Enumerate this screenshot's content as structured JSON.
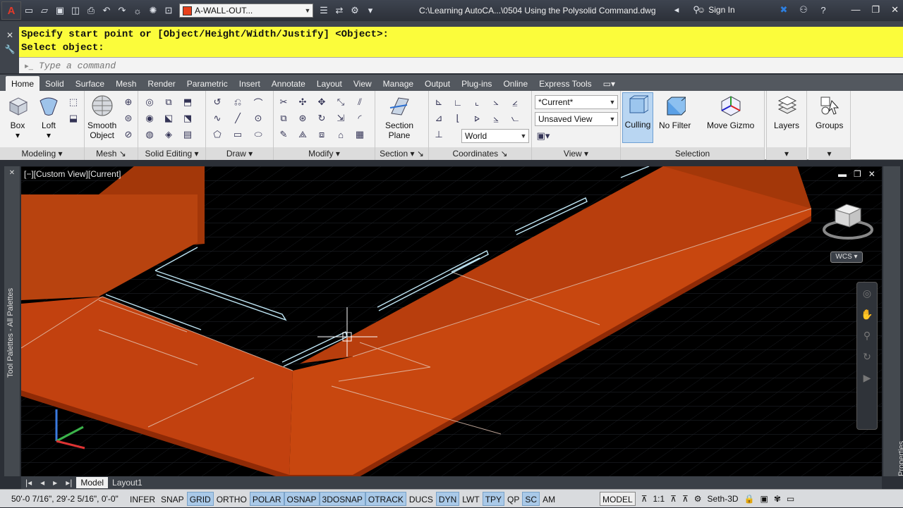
{
  "titlebar": {
    "layer_name": "A-WALL-OUT...",
    "file_title": "C:\\Learning AutoCA...\\0504 Using the Polysolid Command.dwg",
    "signin": "Sign In",
    "layer_color": "#e8401c"
  },
  "command": {
    "history": [
      "Specify start point or [Object/Height/Width/Justify] <Object>:",
      "Select object:"
    ],
    "placeholder": "Type a command",
    "highlight_color": "#fbfc3b"
  },
  "ribbon": {
    "tabs": [
      "Home",
      "Solid",
      "Surface",
      "Mesh",
      "Render",
      "Parametric",
      "Insert",
      "Annotate",
      "Layout",
      "View",
      "Manage",
      "Output",
      "Plug-ins",
      "Online",
      "Express Tools"
    ],
    "active_tab": "Home",
    "panels": {
      "modeling": "Modeling",
      "mesh": "Mesh",
      "solid_editing": "Solid Editing",
      "draw": "Draw",
      "modify": "Modify",
      "section": "Section",
      "coordinates": "Coordinates",
      "view": "View",
      "selection": "Selection"
    },
    "buttons": {
      "box": "Box",
      "loft": "Loft",
      "smooth_object": [
        "Smooth",
        "Object"
      ],
      "section_plane": [
        "Section",
        "Plane"
      ],
      "culling": "Culling",
      "no_filter": "No Filter",
      "move_gizmo": "Move Gizmo",
      "layers": "Layers",
      "groups": "Groups"
    },
    "combos": {
      "visual_style": "*Current*",
      "named_view": "Unsaved View",
      "ucs": "World"
    }
  },
  "viewport": {
    "label": "[−][Custom View][Current]",
    "wcs": "WCS"
  },
  "palettes": {
    "left": "Tool Palettes - All Palettes",
    "right": "Properties"
  },
  "layout_tabs": [
    "Model",
    "Layout1"
  ],
  "status": {
    "coords": "50'-0 7/16\", 29'-2 5/16\", 0'-0\"",
    "toggles": [
      {
        "label": "INFER",
        "on": false
      },
      {
        "label": "SNAP",
        "on": false
      },
      {
        "label": "GRID",
        "on": true
      },
      {
        "label": "ORTHO",
        "on": false
      },
      {
        "label": "POLAR",
        "on": true
      },
      {
        "label": "OSNAP",
        "on": true
      },
      {
        "label": "3DOSNAP",
        "on": true
      },
      {
        "label": "OTRACK",
        "on": true
      },
      {
        "label": "DUCS",
        "on": false
      },
      {
        "label": "DYN",
        "on": true
      },
      {
        "label": "LWT",
        "on": false
      },
      {
        "label": "TPY",
        "on": true
      },
      {
        "label": "QP",
        "on": false
      },
      {
        "label": "SC",
        "on": true
      },
      {
        "label": "AM",
        "on": false
      }
    ],
    "space": "MODEL",
    "scale": "1:1",
    "workspace": "Seth-3D"
  },
  "colors": {
    "wall": "#c2410f",
    "wall_dark": "#8f2a06",
    "grid": "#2a2f38"
  }
}
